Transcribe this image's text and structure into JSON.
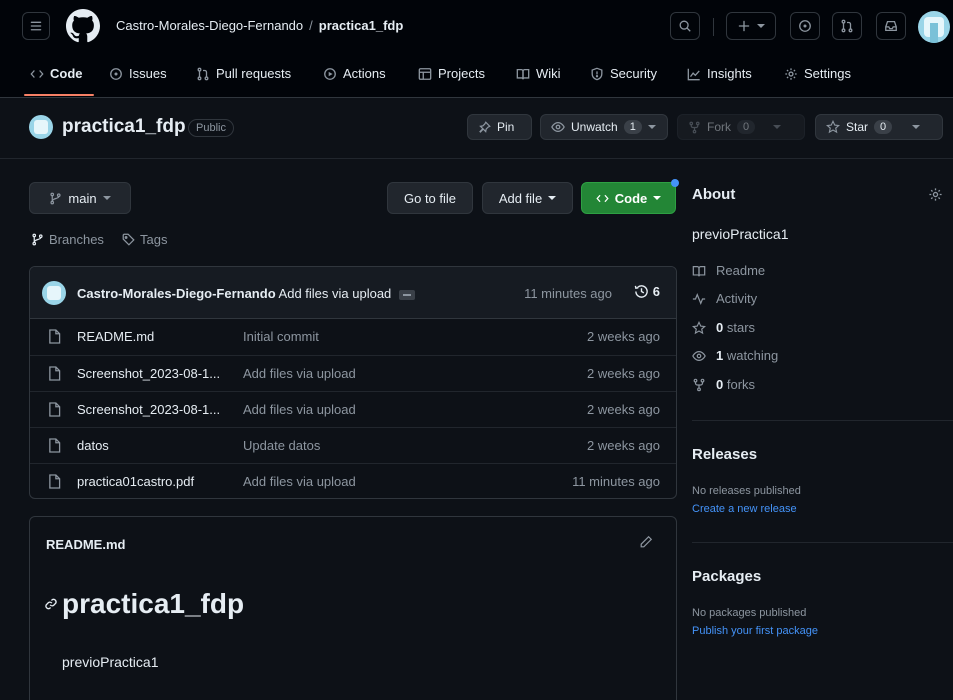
{
  "header": {
    "owner": "Castro-Morales-Diego-Fernando",
    "separator": "/",
    "repo": "practica1_fdp"
  },
  "tabs": [
    {
      "label": "Code",
      "icon": "code-icon"
    },
    {
      "label": "Issues",
      "icon": "issue-icon"
    },
    {
      "label": "Pull requests",
      "icon": "pull-request-icon"
    },
    {
      "label": "Actions",
      "icon": "play-icon"
    },
    {
      "label": "Projects",
      "icon": "table-icon"
    },
    {
      "label": "Wiki",
      "icon": "book-icon"
    },
    {
      "label": "Security",
      "icon": "shield-icon"
    },
    {
      "label": "Insights",
      "icon": "graph-icon"
    },
    {
      "label": "Settings",
      "icon": "gear-icon"
    }
  ],
  "repo_header": {
    "name": "practica1_fdp",
    "visibility": "Public",
    "pin": "Pin",
    "unwatch": "Unwatch",
    "unwatch_count": "1",
    "fork": "Fork",
    "fork_count": "0",
    "star": "Star",
    "star_count": "0"
  },
  "toolbar": {
    "branch": "main",
    "branches": "Branches",
    "tags": "Tags",
    "go_to_file": "Go to file",
    "add_file": "Add file",
    "code": "Code"
  },
  "commit": {
    "author": "Castro-Morales-Diego-Fernando",
    "message": "Add files via upload",
    "time": "11 minutes ago",
    "count": "6"
  },
  "files": [
    {
      "name": "README.md",
      "message": "Initial commit",
      "date": "2 weeks ago"
    },
    {
      "name": "Screenshot_2023-08-1...",
      "message": "Add files via upload",
      "date": "2 weeks ago"
    },
    {
      "name": "Screenshot_2023-08-1...",
      "message": "Add files via upload",
      "date": "2 weeks ago"
    },
    {
      "name": "datos",
      "message": "Update datos",
      "date": "2 weeks ago"
    },
    {
      "name": "practica01castro.pdf",
      "message": "Add files via upload",
      "date": "11 minutes ago"
    }
  ],
  "readme": {
    "filename": "README.md",
    "heading": "practica1_fdp",
    "body": "previoPractica1"
  },
  "about": {
    "title": "About",
    "description": "previoPractica1",
    "readme": "Readme",
    "activity": "Activity",
    "stars_num": "0",
    "stars_label": "stars",
    "watching_num": "1",
    "watching_label": "watching",
    "forks_num": "0",
    "forks_label": "forks"
  },
  "releases": {
    "title": "Releases",
    "empty": "No releases published",
    "link": "Create a new release"
  },
  "packages": {
    "title": "Packages",
    "empty": "No packages published",
    "link": "Publish your first package"
  },
  "colors": {
    "background": "#0d1117",
    "header": "#010409",
    "border": "#30363d",
    "muted": "#8d96a0",
    "link": "#4493f8",
    "green_button": "#238636",
    "tab_underline": "#f78166"
  }
}
